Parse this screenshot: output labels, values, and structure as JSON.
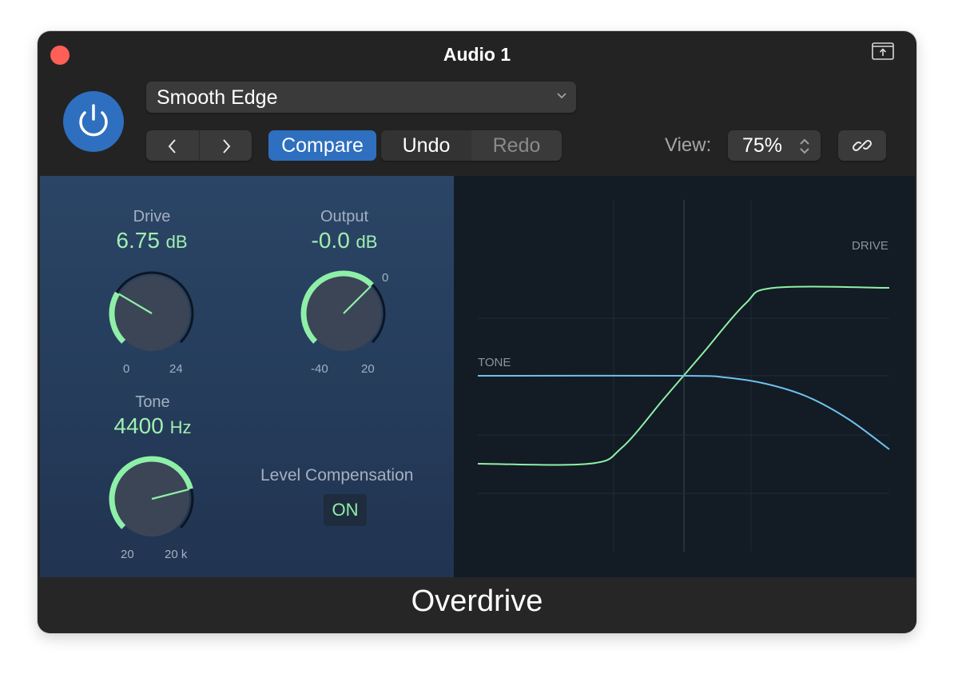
{
  "window": {
    "title": "Audio 1",
    "plugin_name": "Overdrive"
  },
  "header": {
    "power_state": "on",
    "preset": "Smooth Edge",
    "compare_label": "Compare",
    "undo_label": "Undo",
    "redo_label": "Redo",
    "view_label": "View:",
    "view_value": "75%"
  },
  "colors": {
    "accent_blue": "#2f6fbf",
    "value_green": "#9ff0b0",
    "tone_curve": "#6ec1ec",
    "drive_curve": "#8ef0a8",
    "close_red": "#fe5f57"
  },
  "controls": {
    "drive": {
      "name": "Drive",
      "value": "6.75",
      "unit": "dB",
      "min_label": "0",
      "max_label": "24",
      "fraction": 0.28
    },
    "output": {
      "name": "Output",
      "value": "-0.0",
      "unit": "dB",
      "min_label": "-40",
      "max_label": "20",
      "zero_label": "0",
      "fraction": 0.667
    },
    "tone": {
      "name": "Tone",
      "value": "4400",
      "unit": "Hz",
      "min_label": "20",
      "max_label": "20 k",
      "fraction": 0.78
    },
    "level_compensation": {
      "label": "Level Compensation",
      "state": "ON"
    }
  },
  "chart_data": {
    "type": "line",
    "title": "",
    "xlabel": "",
    "ylabel": "",
    "grid": true,
    "series": [
      {
        "name": "DRIVE",
        "label_position": "top-right",
        "description": "transfer curve: flat low, steep S-rise through center, flat high",
        "x": [
          0,
          0.27,
          0.35,
          0.45,
          0.5,
          0.55,
          0.65,
          0.72,
          1.0
        ],
        "y": [
          -0.55,
          -0.55,
          -0.45,
          -0.15,
          0.0,
          0.15,
          0.45,
          0.55,
          0.55
        ]
      },
      {
        "name": "TONE",
        "label_position": "left",
        "description": "low-pass response: flat, rolling off past center",
        "x": [
          0,
          0.5,
          0.6,
          0.7,
          0.8,
          0.9,
          1.0
        ],
        "y": [
          0.0,
          0.0,
          -0.01,
          -0.05,
          -0.13,
          -0.27,
          -0.46
        ]
      }
    ]
  }
}
